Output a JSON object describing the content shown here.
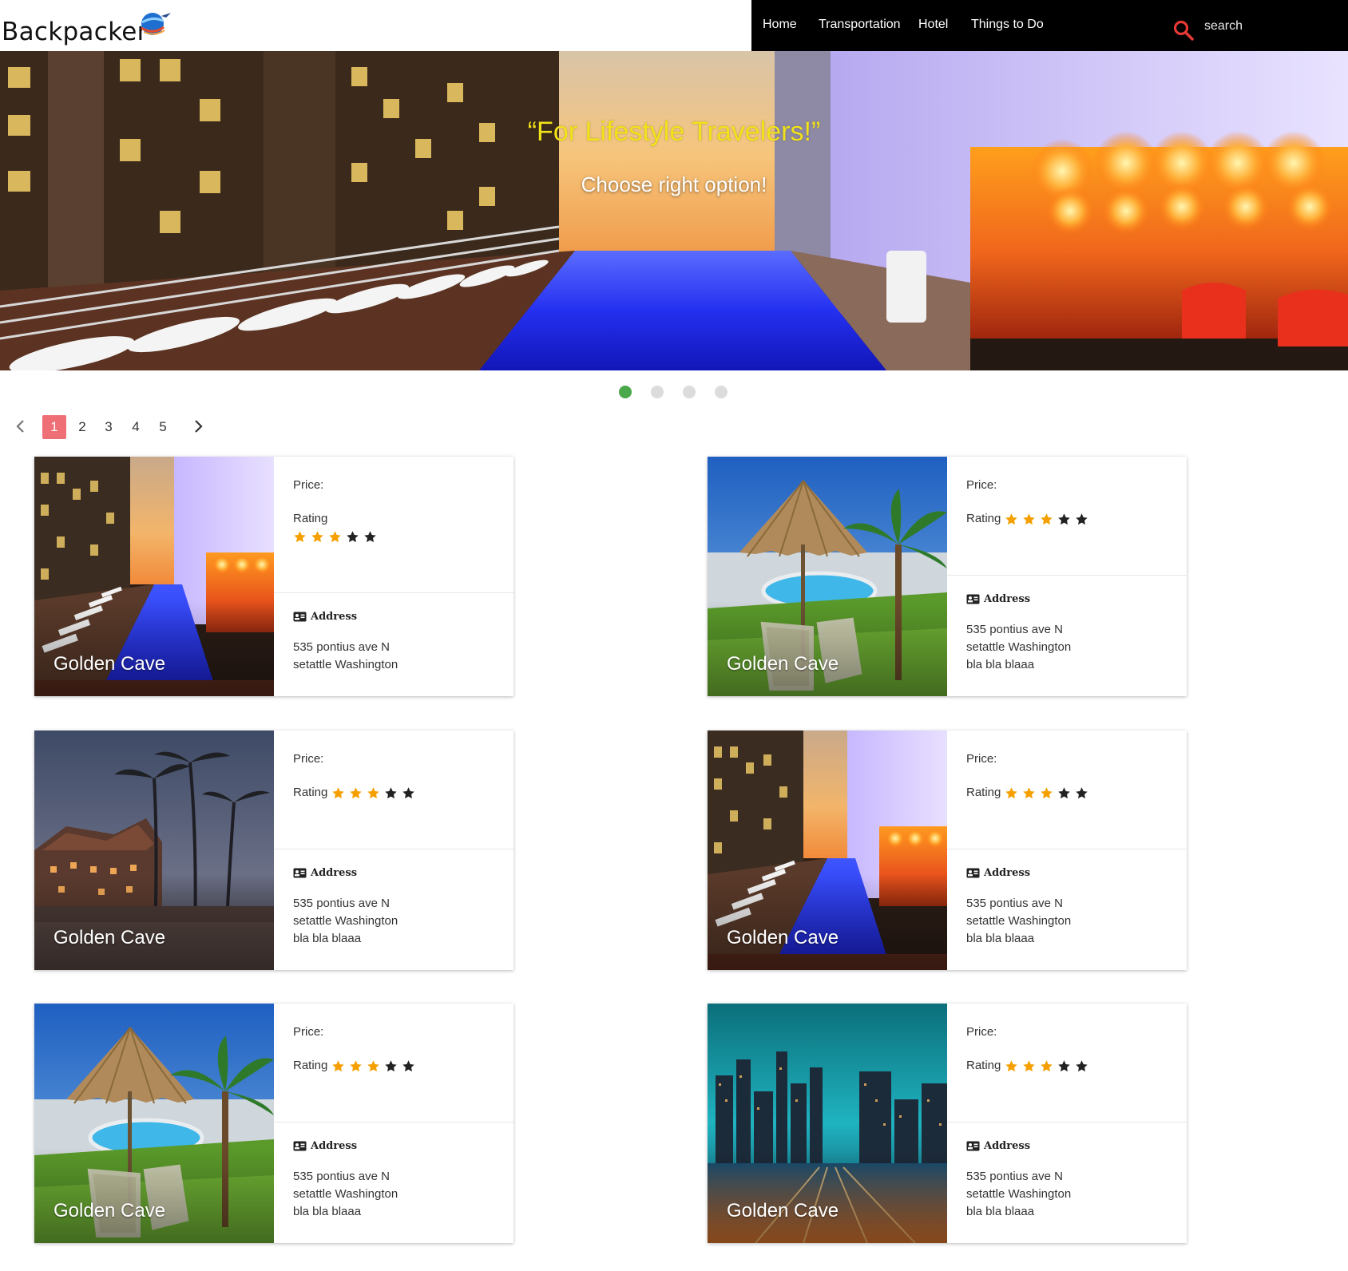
{
  "header": {
    "brand": "Backpacker",
    "nav": [
      "Home",
      "Transportation",
      "Hotel",
      "Things to Do"
    ],
    "search_placeholder": "search"
  },
  "hero": {
    "quote": "“For Lifestyle Travelers!”",
    "subtitle": "Choose right option!",
    "active_slide": 1,
    "slide_count": 4
  },
  "pagination": {
    "pages": [
      "1",
      "2",
      "3",
      "4",
      "5"
    ],
    "current": "1"
  },
  "cards": [
    {
      "title": "Golden Cave",
      "price_label": "Price:",
      "rating_label": "Rating",
      "stars": 3,
      "max_stars": 5,
      "address_label": "Address",
      "address": [
        "535 pontius ave N",
        "setattle Washington"
      ],
      "image": "rooftop-pool"
    },
    {
      "title": "Golden Cave",
      "price_label": "Price:",
      "rating_label": "Rating",
      "stars": 3,
      "max_stars": 5,
      "address_label": "Address",
      "address": [
        "535 pontius ave N",
        "setattle Washington",
        "bla bla blaaa"
      ],
      "image": "palm-umbrella-pool"
    },
    {
      "title": "Golden Cave",
      "price_label": "Price:",
      "rating_label": "Rating",
      "stars": 3,
      "max_stars": 5,
      "address_label": "Address",
      "address": [
        "535 pontius ave N",
        "setattle Washington",
        "bla bla blaaa"
      ],
      "image": "tropical-resort-dusk"
    },
    {
      "title": "Golden Cave",
      "price_label": "Price:",
      "rating_label": "Rating",
      "stars": 3,
      "max_stars": 5,
      "address_label": "Address",
      "address": [
        "535 pontius ave N",
        "setattle Washington",
        "bla bla blaaa"
      ],
      "image": "rooftop-pool"
    },
    {
      "title": "Golden Cave",
      "price_label": "Price:",
      "rating_label": "Rating",
      "stars": 3,
      "max_stars": 5,
      "address_label": "Address",
      "address": [
        "535 pontius ave N",
        "setattle Washington",
        "bla bla blaaa"
      ],
      "image": "palm-umbrella-pool"
    },
    {
      "title": "Golden Cave",
      "price_label": "Price:",
      "rating_label": "Rating",
      "stars": 3,
      "max_stars": 5,
      "address_label": "Address",
      "address": [
        "535 pontius ave N",
        "setattle Washington",
        "bla bla blaaa"
      ],
      "image": "city-marina-night"
    }
  ],
  "colors": {
    "nav_bg": "#000000",
    "search_icon": "#e53935",
    "hero_quote": "#f2e21a",
    "dot_active": "#4aa84a",
    "dot_inactive": "#dcdcdc",
    "page_active": "#ef6f76",
    "star_filled": "#f5a000",
    "star_empty": "#222222"
  },
  "icons": {
    "search": "search-icon",
    "prev": "chevron-left-icon",
    "next": "chevron-right-icon",
    "address": "id-card-icon",
    "star": "star-icon",
    "logo": "globe-logo-icon"
  }
}
